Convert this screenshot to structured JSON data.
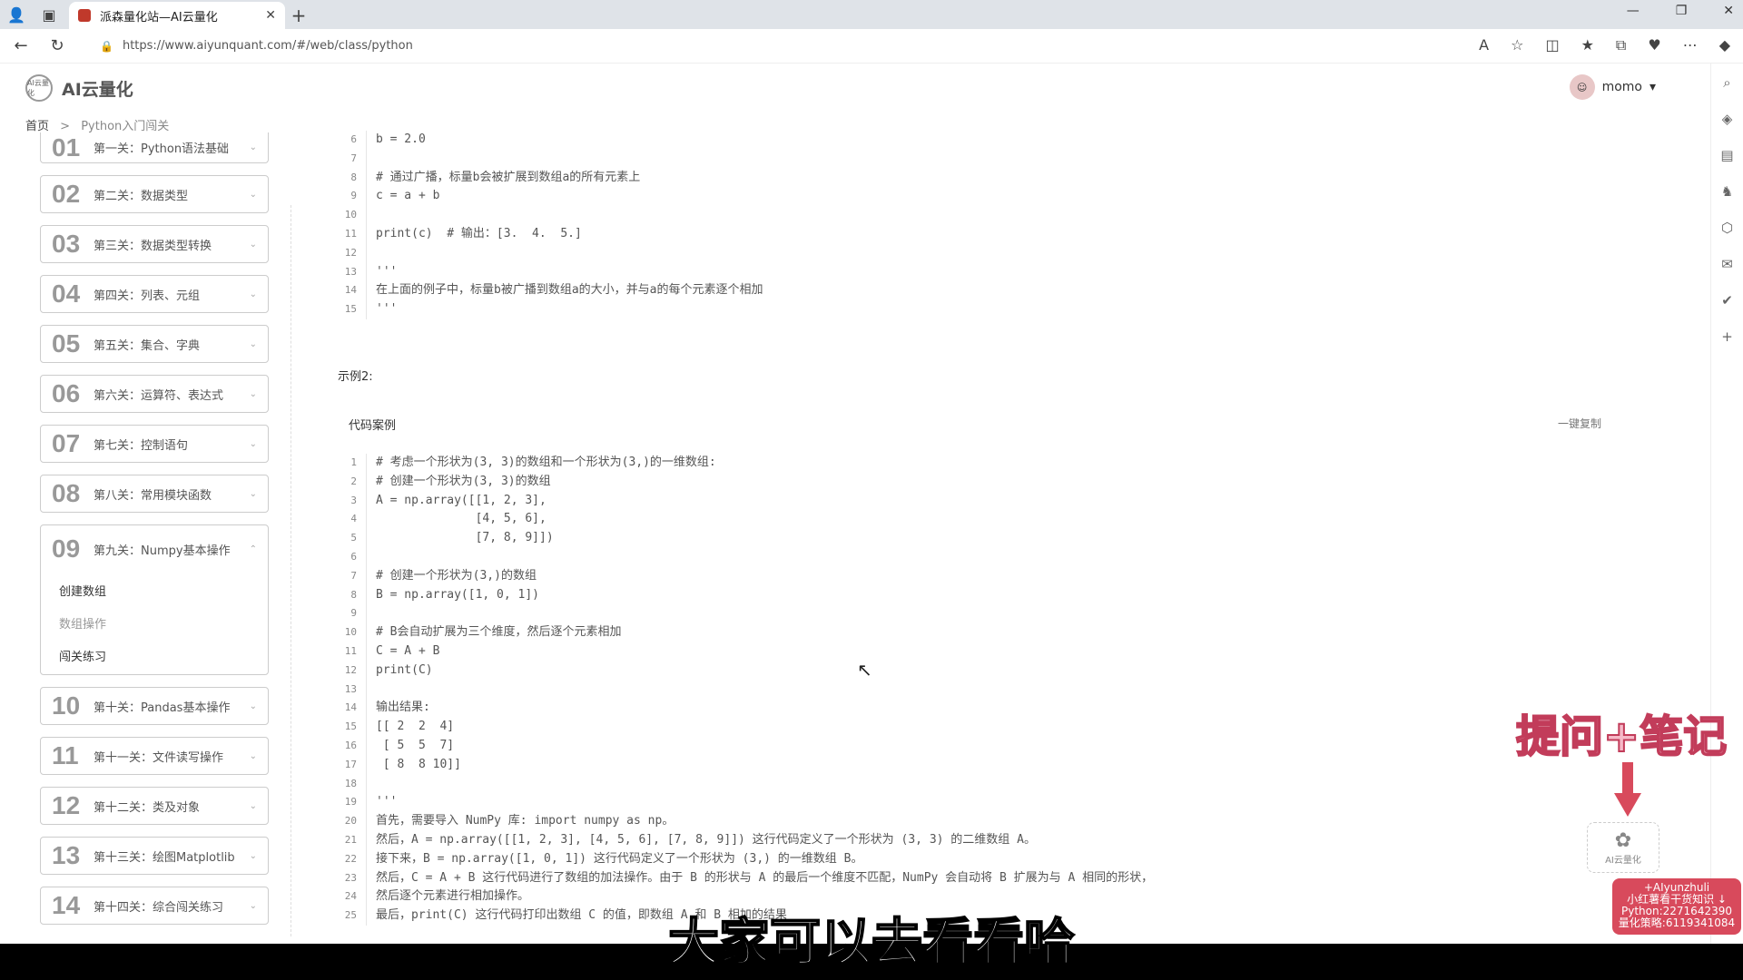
{
  "browser": {
    "tab_title": "派森量化站—AI云量化",
    "url": "https://www.aiyunquant.com/#/web/class/python",
    "close_label": "✕",
    "newtab_label": "+"
  },
  "site": {
    "logo_badge": "AI云量化",
    "logo_text": "AI云量化",
    "user_name": "momo"
  },
  "breadcrumb": {
    "home": "首页",
    "sep": ">",
    "current": "Python入门闯关"
  },
  "sidebar": {
    "levels": [
      {
        "num": "01",
        "name": "第一关：Python语法基础"
      },
      {
        "num": "02",
        "name": "第二关：数据类型"
      },
      {
        "num": "03",
        "name": "第三关：数据类型转换"
      },
      {
        "num": "04",
        "name": "第四关：列表、元组"
      },
      {
        "num": "05",
        "name": "第五关：集合、字典"
      },
      {
        "num": "06",
        "name": "第六关：运算符、表达式"
      },
      {
        "num": "07",
        "name": "第七关：控制语句"
      },
      {
        "num": "08",
        "name": "第八关：常用模块函数"
      },
      {
        "num": "09",
        "name": "第九关：Numpy基本操作"
      },
      {
        "num": "10",
        "name": "第十关：Pandas基本操作"
      },
      {
        "num": "11",
        "name": "第十一关：文件读写操作"
      },
      {
        "num": "12",
        "name": "第十二关：类及对象"
      },
      {
        "num": "13",
        "name": "第十三关：绘图Matplotlib"
      },
      {
        "num": "14",
        "name": "第十四关：综合闯关练习"
      }
    ],
    "open_sub": [
      "创建数组",
      "数组操作",
      "闯关练习"
    ]
  },
  "example1_lines": [
    {
      "n": "6",
      "t": "b = 2.0"
    },
    {
      "n": "7",
      "t": ""
    },
    {
      "n": "8",
      "t": "# 通过广播，标量b会被扩展到数组a的所有元素上"
    },
    {
      "n": "9",
      "t": "c = a + b"
    },
    {
      "n": "10",
      "t": ""
    },
    {
      "n": "11",
      "t": "print(c)  # 输出：[3.  4.  5.]"
    },
    {
      "n": "12",
      "t": ""
    },
    {
      "n": "13",
      "t": "'''"
    },
    {
      "n": "14",
      "t": "在上面的例子中，标量b被广播到数组a的大小，并与a的每个元素逐个相加"
    },
    {
      "n": "15",
      "t": "'''"
    }
  ],
  "example2": {
    "title": "示例2:",
    "code_label": "代码案例",
    "copy_label": "一键复制",
    "lines": [
      {
        "n": "1",
        "t": "# 考虑一个形状为(3, 3)的数组和一个形状为(3,)的一维数组:"
      },
      {
        "n": "2",
        "t": "# 创建一个形状为(3, 3)的数组"
      },
      {
        "n": "3",
        "t": "A = np.array([[1, 2, 3],"
      },
      {
        "n": "4",
        "t": "              [4, 5, 6],"
      },
      {
        "n": "5",
        "t": "              [7, 8, 9]])"
      },
      {
        "n": "6",
        "t": ""
      },
      {
        "n": "7",
        "t": "# 创建一个形状为(3,)的数组"
      },
      {
        "n": "8",
        "t": "B = np.array([1, 0, 1])"
      },
      {
        "n": "9",
        "t": ""
      },
      {
        "n": "10",
        "t": "# B会自动扩展为三个维度，然后逐个元素相加"
      },
      {
        "n": "11",
        "t": "C = A + B"
      },
      {
        "n": "12",
        "t": "print(C)"
      },
      {
        "n": "13",
        "t": ""
      },
      {
        "n": "14",
        "t": "输出结果:"
      },
      {
        "n": "15",
        "t": "[[ 2  2  4]"
      },
      {
        "n": "16",
        "t": " [ 5  5  7]"
      },
      {
        "n": "17",
        "t": " [ 8  8 10]]"
      },
      {
        "n": "18",
        "t": ""
      },
      {
        "n": "19",
        "t": "'''"
      },
      {
        "n": "20",
        "t": "首先，需要导入 NumPy 库: import numpy as np。"
      },
      {
        "n": "21",
        "t": "然后，A = np.array([[1, 2, 3], [4, 5, 6], [7, 8, 9]]) 这行代码定义了一个形状为 (3, 3) 的二维数组 A。"
      },
      {
        "n": "22",
        "t": "接下来，B = np.array([1, 0, 1]) 这行代码定义了一个形状为 (3,) 的一维数组 B。"
      },
      {
        "n": "23",
        "t": "然后，C = A + B 这行代码进行了数组的加法操作。由于 B 的形状与 A 的最后一个维度不匹配，NumPy 会自动将 B 扩展为与 A 相同的形状，"
      },
      {
        "n": "24",
        "t": "然后逐个元素进行相加操作。"
      },
      {
        "n": "25",
        "t": "最后，print(C) 这行代码打印出数组 C 的值，即数组 A 和 B 相加的结果"
      }
    ]
  },
  "overlay": {
    "sticker": "提问+笔记",
    "ai_badge": "AI云量化",
    "promo_lines": [
      "+AIyunzhuli",
      "小红薯看干货知识 ↓",
      "Python:2271642390",
      "量化策略:6119341084"
    ],
    "subtitle": "大家可以去看看哈"
  },
  "colors": {
    "accent": "#c23c5a",
    "sticker_fill": "#f6b9c8"
  }
}
